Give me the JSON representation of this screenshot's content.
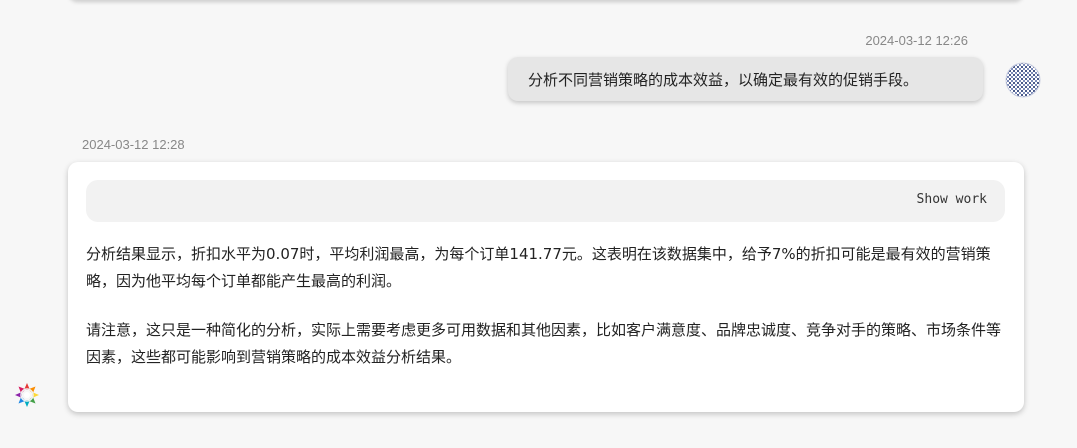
{
  "chat": {
    "user_message": {
      "timestamp": "2024-03-12 12:26",
      "text": "分析不同营销策略的成本效益，以确定最有效的促销手段。",
      "avatar_icon": "user-avatar-icon"
    },
    "assistant_message": {
      "timestamp": "2024-03-12 12:28",
      "show_work_label": "Show work",
      "paragraph_1": "分析结果显示，折扣水平为0.07时，平均利润最高，为每个订单141.77元。这表明在该数据集中，给予7%的折扣可能是最有效的营销策略，因为他平均每个订单都能产生最高的利润。",
      "paragraph_2": "请注意，这只是一种简化的分析，实际上需要考虑更多可用数据和其他因素，比如客户满意度、品牌忠诚度、竞争对手的策略、市场条件等因素，这些都可能影响到营销策略的成本效益分析结果。",
      "avatar_icon": "assistant-logo-icon"
    }
  },
  "colors": {
    "background": "#f7f7f7",
    "card": "#ffffff",
    "user_bubble": "#e6e6e6",
    "show_work_bar": "#f2f2f2",
    "timestamp": "#888888"
  }
}
